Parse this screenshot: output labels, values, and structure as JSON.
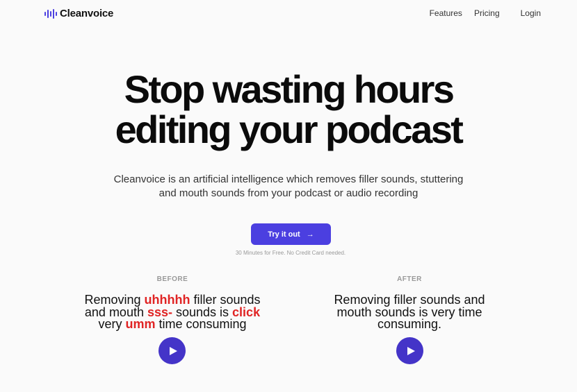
{
  "brand": {
    "name": "Cleanvoice",
    "accent": "#4b3fe0",
    "highlight": "#e02424"
  },
  "nav": {
    "features": "Features",
    "pricing": "Pricing",
    "login": "Login"
  },
  "hero": {
    "title_line1": "Stop wasting hours",
    "title_line2": "editing your podcast",
    "subtitle_line1": "Cleanvoice is an artificial intelligence which removes filler sounds, stuttering",
    "subtitle_line2": "and mouth sounds from your podcast or audio recording"
  },
  "cta": {
    "label": "Try it out",
    "note": "30 Minutes for Free. No Credit Card needed."
  },
  "before": {
    "label": "BEFORE",
    "t1": "Removing ",
    "h1": "uhhhhh",
    "t2": " filler sounds",
    "t3": "and mouth ",
    "h2": "sss-",
    "t4": " sounds is ",
    "h3": "click",
    "t5": "very ",
    "h4": "umm",
    "t6": " time consuming",
    "play_icon": "play-icon"
  },
  "after": {
    "label": "AFTER",
    "line1": "Removing filler sounds and",
    "line2": "mouth sounds is very time",
    "line3": "consuming.",
    "play_icon": "play-icon"
  }
}
